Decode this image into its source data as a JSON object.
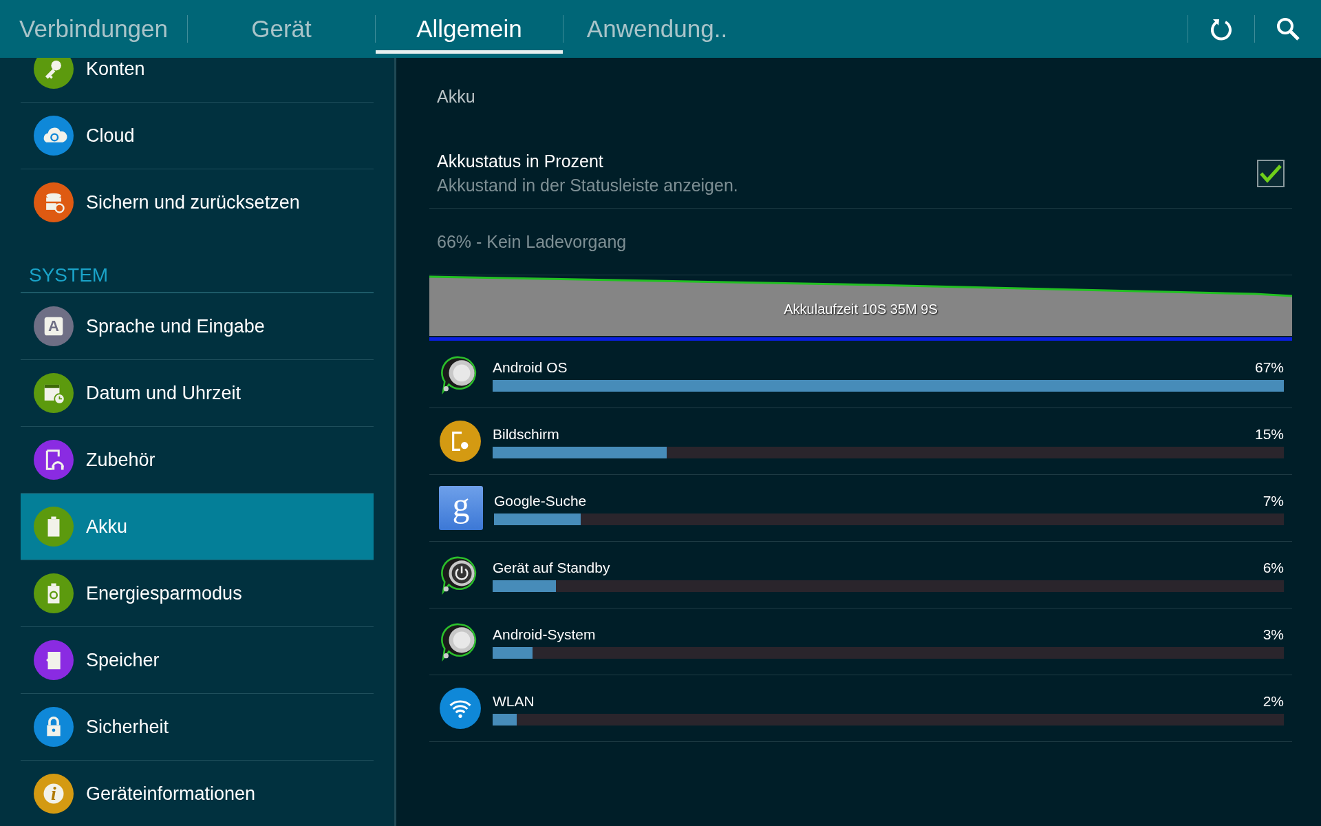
{
  "tabs": [
    {
      "label": "Verbindungen",
      "selected": false
    },
    {
      "label": "Gerät",
      "selected": false
    },
    {
      "label": "Allgemein",
      "selected": true
    },
    {
      "label": "Anwendung..",
      "selected": false
    }
  ],
  "sidebar": {
    "items": [
      {
        "kind": "item",
        "label": "Konten",
        "color": "#5c9a0e",
        "selected": false
      },
      {
        "kind": "item",
        "label": "Cloud",
        "color": "#0f88d8",
        "selected": false
      },
      {
        "kind": "item",
        "label": "Sichern und zurücksetzen",
        "color": "#de5a12",
        "selected": false
      },
      {
        "kind": "section",
        "label": "SYSTEM"
      },
      {
        "kind": "item",
        "label": "Sprache und Eingabe",
        "glyph": "A",
        "color": "#6f6f85",
        "selected": false
      },
      {
        "kind": "item",
        "label": "Datum und Uhrzeit",
        "color": "#5c9a0e",
        "selected": false
      },
      {
        "kind": "item",
        "label": "Zubehör",
        "color": "#8a2be2",
        "selected": false
      },
      {
        "kind": "item",
        "label": "Akku",
        "color": "#5c9a0e",
        "selected": true
      },
      {
        "kind": "item",
        "label": "Energiesparmodus",
        "color": "#5c9a0e",
        "selected": false
      },
      {
        "kind": "item",
        "label": "Speicher",
        "color": "#8a2be2",
        "selected": false
      },
      {
        "kind": "item",
        "label": "Sicherheit",
        "color": "#0f88d8",
        "selected": false
      },
      {
        "kind": "item",
        "label": "Geräteinformationen",
        "glyph": "i",
        "color": "#d49a12",
        "selected": false
      }
    ]
  },
  "panel": {
    "title": "Akku",
    "setting": {
      "title": "Akkustatus in Prozent",
      "subtitle": "Akkustand in der Statusleiste anzeigen.",
      "checked": true
    },
    "status": "66% - Kein Ladevorgang",
    "graph_label": "Akkulaufzeit 10S 35M 9S",
    "usage": [
      {
        "name": "Android OS",
        "percent": "67%",
        "level": 1.0
      },
      {
        "name": "Bildschirm",
        "percent": "15%",
        "level": 0.22
      },
      {
        "name": "Google-Suche",
        "percent": "7%",
        "level": 0.11,
        "glyph": "g"
      },
      {
        "name": "Gerät auf Standby",
        "percent": "6%",
        "level": 0.08
      },
      {
        "name": "Android-System",
        "percent": "3%",
        "level": 0.05
      },
      {
        "name": "WLAN",
        "percent": "2%",
        "level": 0.03
      }
    ]
  }
}
